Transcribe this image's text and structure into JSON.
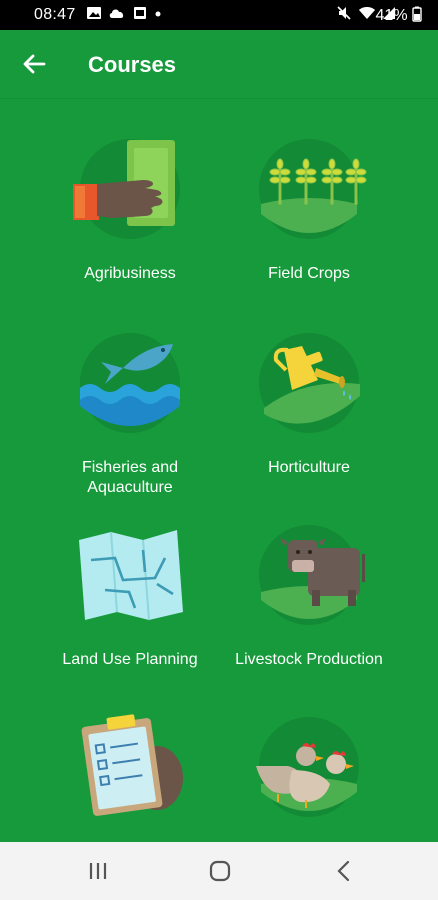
{
  "status_bar": {
    "time": "08:47",
    "battery": "41%",
    "left_icons": [
      "image-icon",
      "cloud-icon",
      "photo-icon",
      "dot-icon"
    ],
    "right_icons": [
      "mute-icon",
      "wifi-icon",
      "signal-icon",
      "battery-icon"
    ]
  },
  "app_bar": {
    "title": "Courses"
  },
  "courses": [
    {
      "label": "Agribusiness",
      "icon": "agribusiness-icon"
    },
    {
      "label": "Field Crops",
      "icon": "field-crops-icon"
    },
    {
      "label": "Fisheries and Aquaculture",
      "icon": "fish-icon"
    },
    {
      "label": "Horticulture",
      "icon": "watering-can-icon"
    },
    {
      "label": "Land Use Planning",
      "icon": "map-icon"
    },
    {
      "label": "Livestock Production",
      "icon": "cow-icon"
    },
    {
      "label": "",
      "icon": "clipboard-icon"
    },
    {
      "label": "",
      "icon": "poultry-icon"
    }
  ],
  "colors": {
    "primary": "#169a3b",
    "circle": "#138a35",
    "nav_bar": "#f3f3f3"
  }
}
